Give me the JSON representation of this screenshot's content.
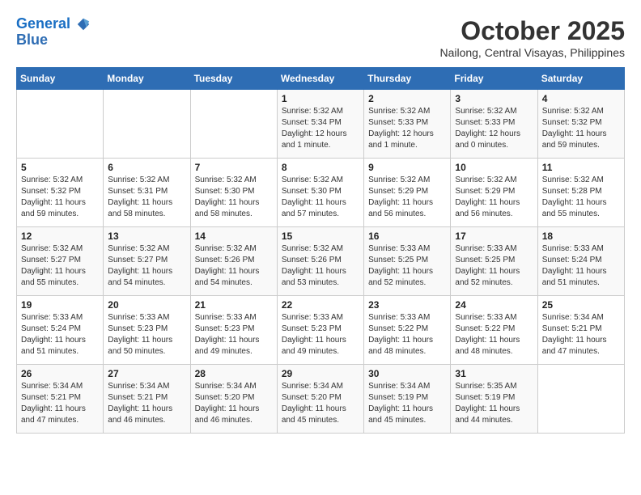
{
  "header": {
    "logo_line1": "General",
    "logo_line2": "Blue",
    "month": "October 2025",
    "location": "Nailong, Central Visayas, Philippines"
  },
  "weekdays": [
    "Sunday",
    "Monday",
    "Tuesday",
    "Wednesday",
    "Thursday",
    "Friday",
    "Saturday"
  ],
  "weeks": [
    [
      {
        "day": "",
        "detail": ""
      },
      {
        "day": "",
        "detail": ""
      },
      {
        "day": "",
        "detail": ""
      },
      {
        "day": "1",
        "detail": "Sunrise: 5:32 AM\nSunset: 5:34 PM\nDaylight: 12 hours\nand 1 minute."
      },
      {
        "day": "2",
        "detail": "Sunrise: 5:32 AM\nSunset: 5:33 PM\nDaylight: 12 hours\nand 1 minute."
      },
      {
        "day": "3",
        "detail": "Sunrise: 5:32 AM\nSunset: 5:33 PM\nDaylight: 12 hours\nand 0 minutes."
      },
      {
        "day": "4",
        "detail": "Sunrise: 5:32 AM\nSunset: 5:32 PM\nDaylight: 11 hours\nand 59 minutes."
      }
    ],
    [
      {
        "day": "5",
        "detail": "Sunrise: 5:32 AM\nSunset: 5:32 PM\nDaylight: 11 hours\nand 59 minutes."
      },
      {
        "day": "6",
        "detail": "Sunrise: 5:32 AM\nSunset: 5:31 PM\nDaylight: 11 hours\nand 58 minutes."
      },
      {
        "day": "7",
        "detail": "Sunrise: 5:32 AM\nSunset: 5:30 PM\nDaylight: 11 hours\nand 58 minutes."
      },
      {
        "day": "8",
        "detail": "Sunrise: 5:32 AM\nSunset: 5:30 PM\nDaylight: 11 hours\nand 57 minutes."
      },
      {
        "day": "9",
        "detail": "Sunrise: 5:32 AM\nSunset: 5:29 PM\nDaylight: 11 hours\nand 56 minutes."
      },
      {
        "day": "10",
        "detail": "Sunrise: 5:32 AM\nSunset: 5:29 PM\nDaylight: 11 hours\nand 56 minutes."
      },
      {
        "day": "11",
        "detail": "Sunrise: 5:32 AM\nSunset: 5:28 PM\nDaylight: 11 hours\nand 55 minutes."
      }
    ],
    [
      {
        "day": "12",
        "detail": "Sunrise: 5:32 AM\nSunset: 5:27 PM\nDaylight: 11 hours\nand 55 minutes."
      },
      {
        "day": "13",
        "detail": "Sunrise: 5:32 AM\nSunset: 5:27 PM\nDaylight: 11 hours\nand 54 minutes."
      },
      {
        "day": "14",
        "detail": "Sunrise: 5:32 AM\nSunset: 5:26 PM\nDaylight: 11 hours\nand 54 minutes."
      },
      {
        "day": "15",
        "detail": "Sunrise: 5:32 AM\nSunset: 5:26 PM\nDaylight: 11 hours\nand 53 minutes."
      },
      {
        "day": "16",
        "detail": "Sunrise: 5:33 AM\nSunset: 5:25 PM\nDaylight: 11 hours\nand 52 minutes."
      },
      {
        "day": "17",
        "detail": "Sunrise: 5:33 AM\nSunset: 5:25 PM\nDaylight: 11 hours\nand 52 minutes."
      },
      {
        "day": "18",
        "detail": "Sunrise: 5:33 AM\nSunset: 5:24 PM\nDaylight: 11 hours\nand 51 minutes."
      }
    ],
    [
      {
        "day": "19",
        "detail": "Sunrise: 5:33 AM\nSunset: 5:24 PM\nDaylight: 11 hours\nand 51 minutes."
      },
      {
        "day": "20",
        "detail": "Sunrise: 5:33 AM\nSunset: 5:23 PM\nDaylight: 11 hours\nand 50 minutes."
      },
      {
        "day": "21",
        "detail": "Sunrise: 5:33 AM\nSunset: 5:23 PM\nDaylight: 11 hours\nand 49 minutes."
      },
      {
        "day": "22",
        "detail": "Sunrise: 5:33 AM\nSunset: 5:23 PM\nDaylight: 11 hours\nand 49 minutes."
      },
      {
        "day": "23",
        "detail": "Sunrise: 5:33 AM\nSunset: 5:22 PM\nDaylight: 11 hours\nand 48 minutes."
      },
      {
        "day": "24",
        "detail": "Sunrise: 5:33 AM\nSunset: 5:22 PM\nDaylight: 11 hours\nand 48 minutes."
      },
      {
        "day": "25",
        "detail": "Sunrise: 5:34 AM\nSunset: 5:21 PM\nDaylight: 11 hours\nand 47 minutes."
      }
    ],
    [
      {
        "day": "26",
        "detail": "Sunrise: 5:34 AM\nSunset: 5:21 PM\nDaylight: 11 hours\nand 47 minutes."
      },
      {
        "day": "27",
        "detail": "Sunrise: 5:34 AM\nSunset: 5:21 PM\nDaylight: 11 hours\nand 46 minutes."
      },
      {
        "day": "28",
        "detail": "Sunrise: 5:34 AM\nSunset: 5:20 PM\nDaylight: 11 hours\nand 46 minutes."
      },
      {
        "day": "29",
        "detail": "Sunrise: 5:34 AM\nSunset: 5:20 PM\nDaylight: 11 hours\nand 45 minutes."
      },
      {
        "day": "30",
        "detail": "Sunrise: 5:34 AM\nSunset: 5:19 PM\nDaylight: 11 hours\nand 45 minutes."
      },
      {
        "day": "31",
        "detail": "Sunrise: 5:35 AM\nSunset: 5:19 PM\nDaylight: 11 hours\nand 44 minutes."
      },
      {
        "day": "",
        "detail": ""
      }
    ]
  ]
}
